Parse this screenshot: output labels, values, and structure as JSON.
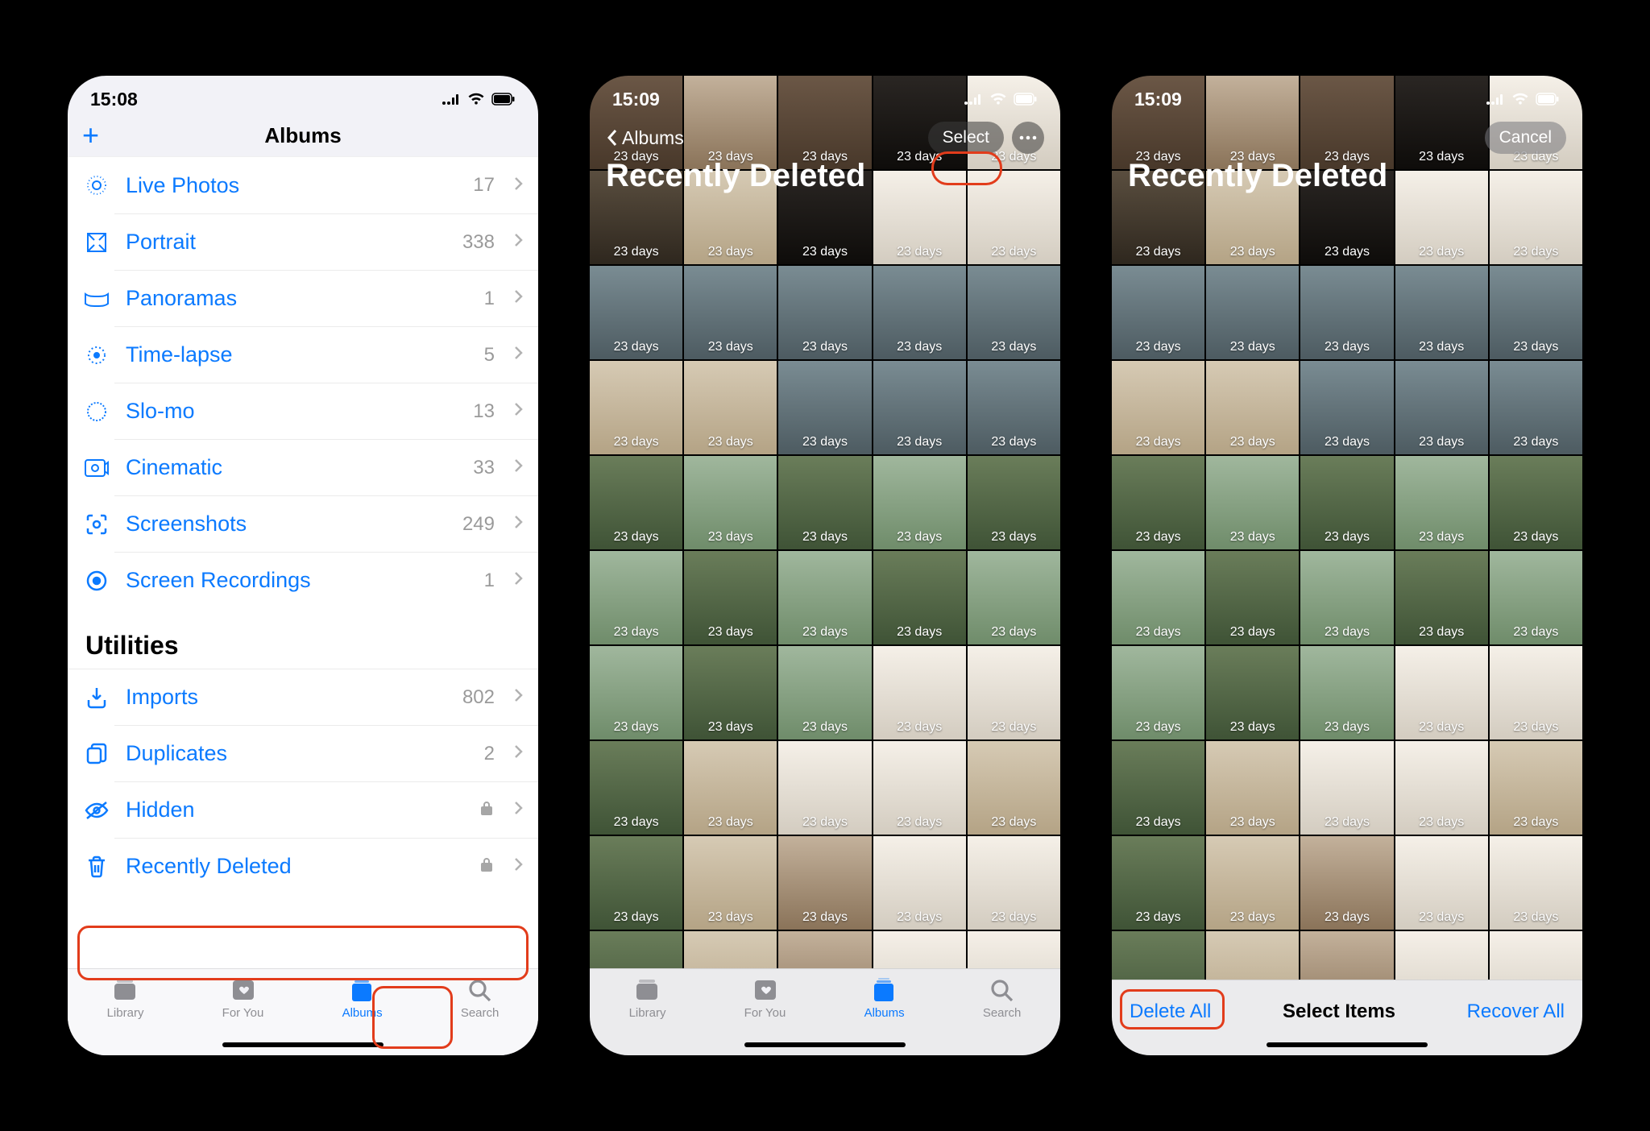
{
  "screen1": {
    "time": "15:08",
    "title": "Albums",
    "media_types": [
      {
        "icon": "live-photos",
        "label": "Live Photos",
        "count": "17"
      },
      {
        "icon": "portrait",
        "label": "Portrait",
        "count": "338"
      },
      {
        "icon": "panoramas",
        "label": "Panoramas",
        "count": "1"
      },
      {
        "icon": "timelapse",
        "label": "Time-lapse",
        "count": "5"
      },
      {
        "icon": "slomo",
        "label": "Slo-mo",
        "count": "13"
      },
      {
        "icon": "cinematic",
        "label": "Cinematic",
        "count": "33"
      },
      {
        "icon": "screenshots",
        "label": "Screenshots",
        "count": "249"
      },
      {
        "icon": "screenrec",
        "label": "Screen Recordings",
        "count": "1"
      }
    ],
    "utilities_header": "Utilities",
    "utilities": [
      {
        "icon": "imports",
        "label": "Imports",
        "count": "802",
        "lock": false
      },
      {
        "icon": "duplicates",
        "label": "Duplicates",
        "count": "2",
        "lock": false
      },
      {
        "icon": "hidden",
        "label": "Hidden",
        "count": "",
        "lock": true
      },
      {
        "icon": "trash",
        "label": "Recently Deleted",
        "count": "",
        "lock": true
      }
    ],
    "tabs": [
      {
        "label": "Library",
        "active": false
      },
      {
        "label": "For You",
        "active": false
      },
      {
        "label": "Albums",
        "active": true
      },
      {
        "label": "Search",
        "active": false
      }
    ]
  },
  "screen2": {
    "time": "15:09",
    "back_label": "Albums",
    "title": "Recently Deleted",
    "select_label": "Select",
    "days_label": "23 days",
    "tabs": [
      {
        "label": "Library",
        "active": false
      },
      {
        "label": "For You",
        "active": false
      },
      {
        "label": "Albums",
        "active": true
      },
      {
        "label": "Search",
        "active": false
      }
    ]
  },
  "screen3": {
    "time": "15:09",
    "title": "Recently Deleted",
    "cancel_label": "Cancel",
    "days_label": "23 days",
    "toolbar": {
      "delete_all": "Delete All",
      "center": "Select Items",
      "recover_all": "Recover All"
    }
  }
}
